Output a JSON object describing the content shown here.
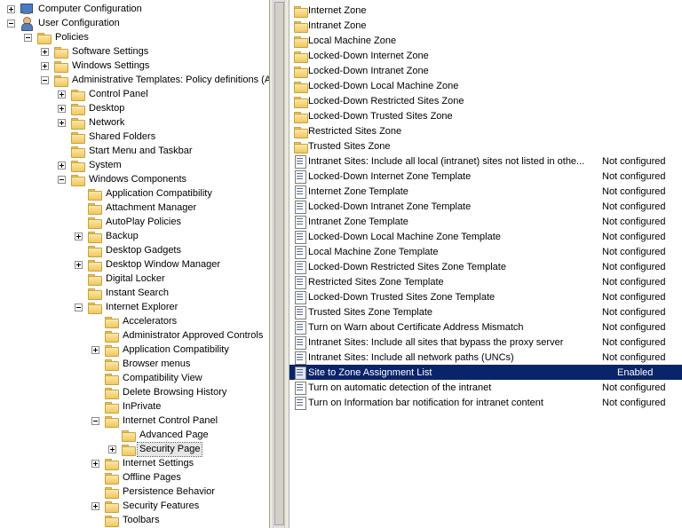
{
  "tree": [
    {
      "label": "Computer Configuration",
      "depth": 0,
      "expander": "plus",
      "icon": "computer-icon",
      "key": "computer-configuration"
    },
    {
      "label": "User Configuration",
      "depth": 0,
      "expander": "minus",
      "icon": "user-icon",
      "key": "user-configuration"
    },
    {
      "label": "Policies",
      "depth": 1,
      "expander": "minus",
      "icon": "folder-icon",
      "key": "policies"
    },
    {
      "label": "Software Settings",
      "depth": 2,
      "expander": "plus",
      "icon": "folder-icon",
      "key": "software-settings"
    },
    {
      "label": "Windows Settings",
      "depth": 2,
      "expander": "plus",
      "icon": "folder-icon",
      "key": "windows-settings"
    },
    {
      "label": "Administrative Templates: Policy definitions (A",
      "depth": 2,
      "expander": "minus",
      "icon": "folder-icon",
      "key": "administrative-templates"
    },
    {
      "label": "Control Panel",
      "depth": 3,
      "expander": "plus",
      "icon": "folder-icon",
      "key": "control-panel"
    },
    {
      "label": "Desktop",
      "depth": 3,
      "expander": "plus",
      "icon": "folder-icon",
      "key": "desktop"
    },
    {
      "label": "Network",
      "depth": 3,
      "expander": "plus",
      "icon": "folder-icon",
      "key": "network"
    },
    {
      "label": "Shared Folders",
      "depth": 3,
      "expander": "none",
      "icon": "folder-icon",
      "key": "shared-folders"
    },
    {
      "label": "Start Menu and Taskbar",
      "depth": 3,
      "expander": "none",
      "icon": "folder-icon",
      "key": "start-menu-and-taskbar"
    },
    {
      "label": "System",
      "depth": 3,
      "expander": "plus",
      "icon": "folder-icon",
      "key": "system"
    },
    {
      "label": "Windows Components",
      "depth": 3,
      "expander": "minus",
      "icon": "folder-icon",
      "key": "windows-components"
    },
    {
      "label": "Application Compatibility",
      "depth": 4,
      "expander": "none",
      "icon": "folder-icon",
      "key": "application-compatibility"
    },
    {
      "label": "Attachment Manager",
      "depth": 4,
      "expander": "none",
      "icon": "folder-icon",
      "key": "attachment-manager"
    },
    {
      "label": "AutoPlay Policies",
      "depth": 4,
      "expander": "none",
      "icon": "folder-icon",
      "key": "autoplay-policies"
    },
    {
      "label": "Backup",
      "depth": 4,
      "expander": "plus",
      "icon": "folder-icon",
      "key": "backup"
    },
    {
      "label": "Desktop Gadgets",
      "depth": 4,
      "expander": "none",
      "icon": "folder-icon",
      "key": "desktop-gadgets"
    },
    {
      "label": "Desktop Window Manager",
      "depth": 4,
      "expander": "plus",
      "icon": "folder-icon",
      "key": "desktop-window-manager"
    },
    {
      "label": "Digital Locker",
      "depth": 4,
      "expander": "none",
      "icon": "folder-icon",
      "key": "digital-locker"
    },
    {
      "label": "Instant Search",
      "depth": 4,
      "expander": "none",
      "icon": "folder-icon",
      "key": "instant-search"
    },
    {
      "label": "Internet Explorer",
      "depth": 4,
      "expander": "minus",
      "icon": "folder-icon",
      "key": "internet-explorer"
    },
    {
      "label": "Accelerators",
      "depth": 5,
      "expander": "none",
      "icon": "folder-icon",
      "key": "accelerators"
    },
    {
      "label": "Administrator Approved Controls",
      "depth": 5,
      "expander": "none",
      "icon": "folder-icon",
      "key": "administrator-approved-controls"
    },
    {
      "label": "Application Compatibility",
      "depth": 5,
      "expander": "plus",
      "icon": "folder-icon",
      "key": "ie-application-compatibility"
    },
    {
      "label": "Browser menus",
      "depth": 5,
      "expander": "none",
      "icon": "folder-icon",
      "key": "browser-menus"
    },
    {
      "label": "Compatibility View",
      "depth": 5,
      "expander": "none",
      "icon": "folder-icon",
      "key": "compatibility-view"
    },
    {
      "label": "Delete Browsing History",
      "depth": 5,
      "expander": "none",
      "icon": "folder-icon",
      "key": "delete-browsing-history"
    },
    {
      "label": "InPrivate",
      "depth": 5,
      "expander": "none",
      "icon": "folder-icon",
      "key": "inprivate"
    },
    {
      "label": "Internet Control Panel",
      "depth": 5,
      "expander": "minus",
      "icon": "folder-icon",
      "key": "internet-control-panel"
    },
    {
      "label": "Advanced Page",
      "depth": 6,
      "expander": "none",
      "icon": "folder-icon",
      "key": "advanced-page"
    },
    {
      "label": "Security Page",
      "depth": 6,
      "expander": "plus",
      "icon": "folder-icon",
      "key": "security-page",
      "selected": true
    },
    {
      "label": "Internet Settings",
      "depth": 5,
      "expander": "plus",
      "icon": "folder-icon",
      "key": "internet-settings"
    },
    {
      "label": "Offline Pages",
      "depth": 5,
      "expander": "none",
      "icon": "folder-icon",
      "key": "offline-pages"
    },
    {
      "label": "Persistence Behavior",
      "depth": 5,
      "expander": "none",
      "icon": "folder-icon",
      "key": "persistence-behavior"
    },
    {
      "label": "Security Features",
      "depth": 5,
      "expander": "plus",
      "icon": "folder-icon",
      "key": "security-features"
    },
    {
      "label": "Toolbars",
      "depth": 5,
      "expander": "none",
      "icon": "folder-icon",
      "key": "toolbars"
    }
  ],
  "list": [
    {
      "name": "Internet Zone",
      "state": "",
      "icon": "folder-icon"
    },
    {
      "name": "Intranet Zone",
      "state": "",
      "icon": "folder-icon"
    },
    {
      "name": "Local Machine Zone",
      "state": "",
      "icon": "folder-icon"
    },
    {
      "name": "Locked-Down Internet Zone",
      "state": "",
      "icon": "folder-icon"
    },
    {
      "name": "Locked-Down Intranet Zone",
      "state": "",
      "icon": "folder-icon"
    },
    {
      "name": "Locked-Down Local Machine Zone",
      "state": "",
      "icon": "folder-icon"
    },
    {
      "name": "Locked-Down Restricted Sites Zone",
      "state": "",
      "icon": "folder-icon"
    },
    {
      "name": "Locked-Down Trusted Sites Zone",
      "state": "",
      "icon": "folder-icon"
    },
    {
      "name": "Restricted Sites Zone",
      "state": "",
      "icon": "folder-icon"
    },
    {
      "name": "Trusted Sites Zone",
      "state": "",
      "icon": "folder-icon"
    },
    {
      "name": "Intranet Sites: Include all local (intranet) sites not listed in othe...",
      "state": "Not configured",
      "icon": "policy-setting-icon"
    },
    {
      "name": "Locked-Down Internet Zone Template",
      "state": "Not configured",
      "icon": "policy-setting-icon"
    },
    {
      "name": "Internet Zone Template",
      "state": "Not configured",
      "icon": "policy-setting-icon"
    },
    {
      "name": "Locked-Down Intranet Zone Template",
      "state": "Not configured",
      "icon": "policy-setting-icon"
    },
    {
      "name": "Intranet Zone Template",
      "state": "Not configured",
      "icon": "policy-setting-icon"
    },
    {
      "name": "Locked-Down Local Machine Zone Template",
      "state": "Not configured",
      "icon": "policy-setting-icon"
    },
    {
      "name": "Local Machine Zone Template",
      "state": "Not configured",
      "icon": "policy-setting-icon"
    },
    {
      "name": "Locked-Down Restricted Sites Zone Template",
      "state": "Not configured",
      "icon": "policy-setting-icon"
    },
    {
      "name": "Restricted Sites Zone Template",
      "state": "Not configured",
      "icon": "policy-setting-icon"
    },
    {
      "name": "Locked-Down Trusted Sites Zone Template",
      "state": "Not configured",
      "icon": "policy-setting-icon"
    },
    {
      "name": "Trusted Sites Zone Template",
      "state": "Not configured",
      "icon": "policy-setting-icon"
    },
    {
      "name": "Turn on Warn about Certificate Address Mismatch",
      "state": "Not configured",
      "icon": "policy-setting-icon"
    },
    {
      "name": "Intranet Sites: Include all sites that bypass the proxy server",
      "state": "Not configured",
      "icon": "policy-setting-icon"
    },
    {
      "name": "Intranet Sites: Include all network paths (UNCs)",
      "state": "Not configured",
      "icon": "policy-setting-icon"
    },
    {
      "name": "Site to Zone Assignment List",
      "state": "Enabled",
      "icon": "policy-setting-icon",
      "selected": true
    },
    {
      "name": "Turn on automatic detection of the intranet",
      "state": "Not configured",
      "icon": "policy-setting-icon"
    },
    {
      "name": "Turn on Information bar notification for intranet content",
      "state": "Not configured",
      "icon": "policy-setting-icon"
    }
  ],
  "colors": {
    "selection_background": "#0a246a",
    "selection_text": "#ffffff",
    "tree_selection_background": "#e6e6e6",
    "folder_fill": "#f0c75e"
  }
}
